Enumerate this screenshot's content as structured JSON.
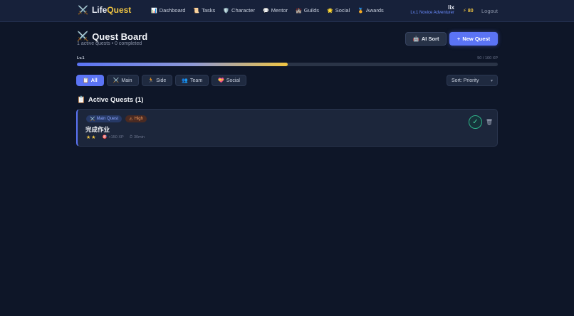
{
  "nav": {
    "brand_icon": "⚔️",
    "brand_part1": "Life",
    "brand_part2": "Quest",
    "links": [
      {
        "icon": "📊",
        "label": "Dashboard"
      },
      {
        "icon": "📜",
        "label": "Tasks"
      },
      {
        "icon": "🛡️",
        "label": "Character"
      },
      {
        "icon": "💬",
        "label": "Mentor"
      },
      {
        "icon": "🏰",
        "label": "Guilds"
      },
      {
        "icon": "🌟",
        "label": "Social"
      },
      {
        "icon": "🏅",
        "label": "Awards"
      }
    ],
    "user_name": "lix",
    "user_title": "Lv.1 Novice Adventurer",
    "coins_icon": "⚡",
    "coins": "80",
    "logout": "Logout"
  },
  "header": {
    "title_icon": "⚔️",
    "title": "Quest Board",
    "subtitle": "1 active quests • 0 completed",
    "ai_sort_icon": "🤖",
    "ai_sort": "AI Sort",
    "new_quest_icon": "+",
    "new_quest": "New Quest"
  },
  "level": {
    "label": "Lv.1",
    "xp_text": "50 / 100 XP",
    "progress": 0.5
  },
  "filters": [
    {
      "icon": "📋",
      "label": "All",
      "active": true
    },
    {
      "icon": "⚔️",
      "label": "Main",
      "active": false
    },
    {
      "icon": "🏃",
      "label": "Side",
      "active": false
    },
    {
      "icon": "👥",
      "label": "Team",
      "active": false
    },
    {
      "icon": "💝",
      "label": "Social",
      "active": false
    }
  ],
  "sort": {
    "selected": "Sort: Priority"
  },
  "section": {
    "icon": "📋",
    "title": "Active Quests (1)"
  },
  "quests": [
    {
      "type_icon": "⚔️",
      "type": "Main Quest",
      "priority_icon": "⚠",
      "priority": "High",
      "name": "完成作业",
      "stars": "★★",
      "xp_icon": "🎯",
      "xp": "+150 XP",
      "time_icon": "⏱",
      "time": "30min",
      "complete_icon": "✓",
      "delete_icon": "🗑"
    }
  ],
  "colors": {
    "background": "#0e1628",
    "accent": "#5b74f5",
    "gold": "#f0c542",
    "success": "#45d6a4"
  }
}
